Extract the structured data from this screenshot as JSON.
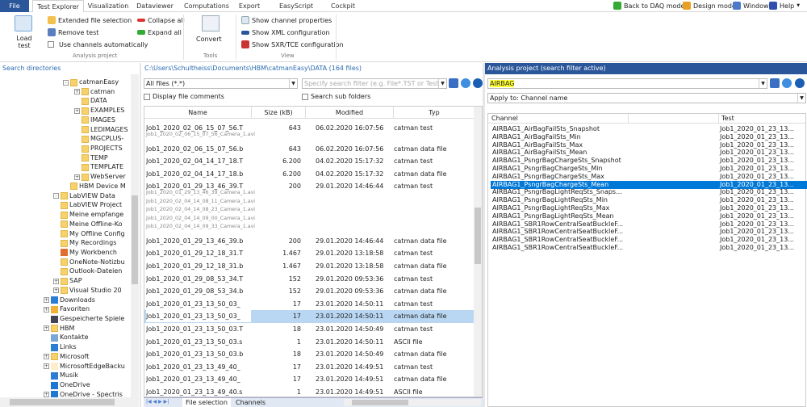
{
  "tabs": [
    "File",
    "Test Explorer",
    "Visualization",
    "Dataviewer",
    "Computations",
    "Export",
    "EasyScript editor",
    "Cockpit"
  ],
  "topright": {
    "daq": "Back to DAQ mode",
    "design": "Design mode",
    "window": "Window",
    "help": "Help"
  },
  "ribbon": {
    "load": "Load test",
    "extended": "Extended file selection",
    "remove": "Remove test",
    "use_auto": "Use channels automatically",
    "collapse": "Collapse all",
    "expand": "Expand all",
    "group_analysis": "Analysis project",
    "convert": "Convert",
    "group_tools": "Tools",
    "show_props": "Show channel properties",
    "show_xml": "Show XML configuration",
    "show_sxr": "Show SXR/TCE configuration",
    "group_view": "View"
  },
  "left": {
    "title": "Search directories",
    "tree": [
      {
        "label": "catmanEasy",
        "lvl": 5,
        "pm": "-"
      },
      {
        "label": "catman",
        "lvl": 6,
        "pm": "+"
      },
      {
        "label": "DATA",
        "lvl": 6
      },
      {
        "label": "EXAMPLES",
        "lvl": 6,
        "pm": "+"
      },
      {
        "label": "IMAGES",
        "lvl": 6
      },
      {
        "label": "LEDIMAGES",
        "lvl": 6
      },
      {
        "label": "MGCPLUS-",
        "lvl": 6
      },
      {
        "label": "PROJECTS",
        "lvl": 6
      },
      {
        "label": "TEMP",
        "lvl": 6
      },
      {
        "label": "TEMPLATE",
        "lvl": 6
      },
      {
        "label": "WebServer",
        "lvl": 6,
        "pm": "+"
      },
      {
        "label": "HBM Device M",
        "lvl": 5
      },
      {
        "label": "LabVIEW Data",
        "lvl": 4,
        "pm": "-"
      },
      {
        "label": "LabVIEW Project",
        "lvl": 4
      },
      {
        "label": "Meine empfange",
        "lvl": 4
      },
      {
        "label": "Meine Offline-Ko",
        "lvl": 4
      },
      {
        "label": "My Offline Config",
        "lvl": 4
      },
      {
        "label": "My Recordings",
        "lvl": 4
      },
      {
        "label": "My Workbench",
        "lvl": 4,
        "icon": "workbench"
      },
      {
        "label": "OneNote-Notizbu",
        "lvl": 4
      },
      {
        "label": "Outlook-Dateien",
        "lvl": 4
      },
      {
        "label": "SAP",
        "lvl": 4,
        "pm": "+"
      },
      {
        "label": "Visual Studio 20",
        "lvl": 4,
        "pm": "+"
      },
      {
        "label": "Downloads",
        "lvl": 3,
        "pm": "+",
        "icon": "download"
      },
      {
        "label": "Favoriten",
        "lvl": 3,
        "pm": "+",
        "icon": "star"
      },
      {
        "label": "Gespeicherte Spiele",
        "lvl": 3,
        "icon": "game"
      },
      {
        "label": "HBM",
        "lvl": 3,
        "pm": "+"
      },
      {
        "label": "Kontakte",
        "lvl": 3,
        "icon": "contact"
      },
      {
        "label": "Links",
        "lvl": 3,
        "icon": "link"
      },
      {
        "label": "Microsoft",
        "lvl": 3,
        "pm": "+"
      },
      {
        "label": "MicrosoftEdgeBacku",
        "lvl": 3,
        "pm": "+",
        "icon": "paper"
      },
      {
        "label": "Musik",
        "lvl": 3,
        "icon": "music"
      },
      {
        "label": "OneDrive",
        "lvl": 3,
        "icon": "cloud"
      },
      {
        "label": "OneDrive - Spectris",
        "lvl": 3,
        "pm": "+",
        "icon": "cloud"
      }
    ]
  },
  "middle": {
    "path": "C:\\Users\\Schultheiss\\Documents\\HBM\\catmanEasy\\DATA (164 files)",
    "filter": "All files (*.*)",
    "search_placeholder": "Specify search filter (e.g. File*.TST or Test",
    "display_comments": "Display file comments",
    "search_sub": "Search sub folders",
    "columns": [
      "Name",
      "Size (kB)",
      "Modified",
      "Typ"
    ],
    "files": [
      {
        "name": "Job1_2020_02_06_15_07_56.T",
        "size": "643",
        "mod": "06.02.2020 16:07:56",
        "typ": "catman test",
        "subs": [
          "Job1_2020_02_06_15_07_56_Camera_1.avi"
        ]
      },
      {
        "name": "Job1_2020_02_06_15_07_56.b",
        "size": "643",
        "mod": "06.02.2020 16:07:56",
        "typ": "catman data file"
      },
      {
        "name": "Job1_2020_02_04_14_17_18.T",
        "size": "6.200",
        "mod": "04.02.2020 15:17:32",
        "typ": "catman test"
      },
      {
        "name": "Job1_2020_02_04_14_17_18.b",
        "size": "6.200",
        "mod": "04.02.2020 15:17:32",
        "typ": "catman data file"
      },
      {
        "name": "Job1_2020_01_29_13_46_39.T",
        "size": "200",
        "mod": "29.01.2020 14:46:44",
        "typ": "catman test",
        "subs": [
          "Job1_2020_01_29_13_46_39_Camera_1.avi",
          "Job1_2020_02_04_14_08_11_Camera_1.avi",
          "Job1_2020_02_04_14_08_23_Camera_1.avi",
          "Job1_2020_02_04_14_09_00_Camera_1.avi",
          "Job1_2020_02_04_14_09_33_Camera_1.avi"
        ]
      },
      {
        "name": "Job1_2020_01_29_13_46_39.b",
        "size": "200",
        "mod": "29.01.2020 14:46:44",
        "typ": "catman data file"
      },
      {
        "name": "Job1_2020_01_29_12_18_31.T",
        "size": "1.467",
        "mod": "29.01.2020 13:18:58",
        "typ": "catman test"
      },
      {
        "name": "Job1_2020_01_29_12_18_31.b",
        "size": "1.467",
        "mod": "29.01.2020 13:18:58",
        "typ": "catman data file"
      },
      {
        "name": "Job1_2020_01_29_08_53_34.T",
        "size": "152",
        "mod": "29.01.2020 09:53:36",
        "typ": "catman test"
      },
      {
        "name": "Job1_2020_01_29_08_53_34.b",
        "size": "152",
        "mod": "29.01.2020 09:53:36",
        "typ": "catman data file"
      },
      {
        "name": "Job1_2020_01_23_13_50_03_",
        "size": "17",
        "mod": "23.01.2020 14:50:11",
        "typ": "catman test"
      },
      {
        "name": "Job1_2020_01_23_13_50_03_",
        "size": "17",
        "mod": "23.01.2020 14:50:11",
        "typ": "catman data file",
        "selected": true
      },
      {
        "name": "Job1_2020_01_23_13_50_03.T",
        "size": "18",
        "mod": "23.01.2020 14:50:49",
        "typ": "catman test"
      },
      {
        "name": "Job1_2020_01_23_13_50_03.s",
        "size": "1",
        "mod": "23.01.2020 14:50:11",
        "typ": "ASCII file"
      },
      {
        "name": "Job1_2020_01_23_13_50_03.b",
        "size": "18",
        "mod": "23.01.2020 14:50:49",
        "typ": "catman data file"
      },
      {
        "name": "Job1_2020_01_23_13_49_40_",
        "size": "17",
        "mod": "23.01.2020 14:49:51",
        "typ": "catman test"
      },
      {
        "name": "Job1_2020_01_23_13_49_40_",
        "size": "17",
        "mod": "23.01.2020 14:49:51",
        "typ": "catman data file"
      },
      {
        "name": "Job1_2020_01_23_13_49_40.s",
        "size": "1",
        "mod": "23.01.2020 14:49:51",
        "typ": "ASCII file"
      }
    ],
    "bottom_tabs": [
      "File selection",
      "Channels"
    ]
  },
  "right": {
    "title": "Analysis project (search filter active)",
    "search": "AIRBAG",
    "apply": "Apply to: Channel name",
    "columns": [
      "Channel",
      "Test"
    ],
    "channels": [
      "AIRBAG1_AirBagFailSts_Snapshot",
      "AIRBAG1_AirBagFailSts_Min",
      "AIRBAG1_AirBagFailSts_Max",
      "AIRBAG1_AirBagFailSts_Mean",
      "AIRBAG1_PsngrBagChargeSts_Snapshot",
      "AIRBAG1_PsngrBagChargeSts_Min",
      "AIRBAG1_PsngrBagChargeSts_Max",
      "AIRBAG1_PsngrBagChargeSts_Mean",
      "AIRBAG1_PsngrBagLightReqSts_Snaps...",
      "AIRBAG1_PsngrBagLightReqSts_Min",
      "AIRBAG1_PsngrBagLightReqSts_Max",
      "AIRBAG1_PsngrBagLightReqSts_Mean",
      "AIRBAG1_SBR1RowCentralSeatBuckleF...",
      "AIRBAG1_SBR1RowCentralSeatBuckleF...",
      "AIRBAG1_SBR1RowCentralSeatBuckleF...",
      "AIRBAG1_SBR1RowCentralSeatBuckleF..."
    ],
    "test": "Job1_2020_01_23_13...",
    "selected_index": 7
  },
  "colors": {
    "accent": "#2b579a",
    "selection": "#0078d7",
    "file_selection": "#b9d7f3",
    "highlight": "#ffff33"
  }
}
